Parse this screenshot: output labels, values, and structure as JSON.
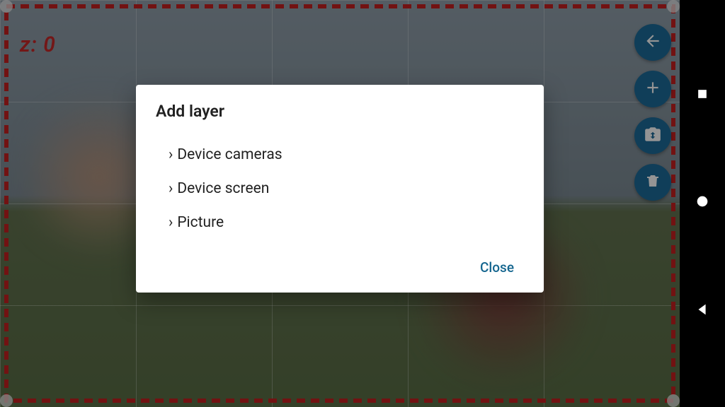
{
  "overlay": {
    "z_indicator": "z: 0"
  },
  "fab": {
    "back": "back-icon",
    "add": "plus-icon",
    "flip": "camera-flip-icon",
    "delete": "trash-icon"
  },
  "dialog": {
    "title": "Add layer",
    "options": [
      {
        "label": "Device cameras"
      },
      {
        "label": "Device screen"
      },
      {
        "label": "Picture"
      }
    ],
    "close_label": "Close"
  },
  "nav": {
    "recent": "square-icon",
    "home": "circle-icon",
    "back": "triangle-back-icon"
  }
}
